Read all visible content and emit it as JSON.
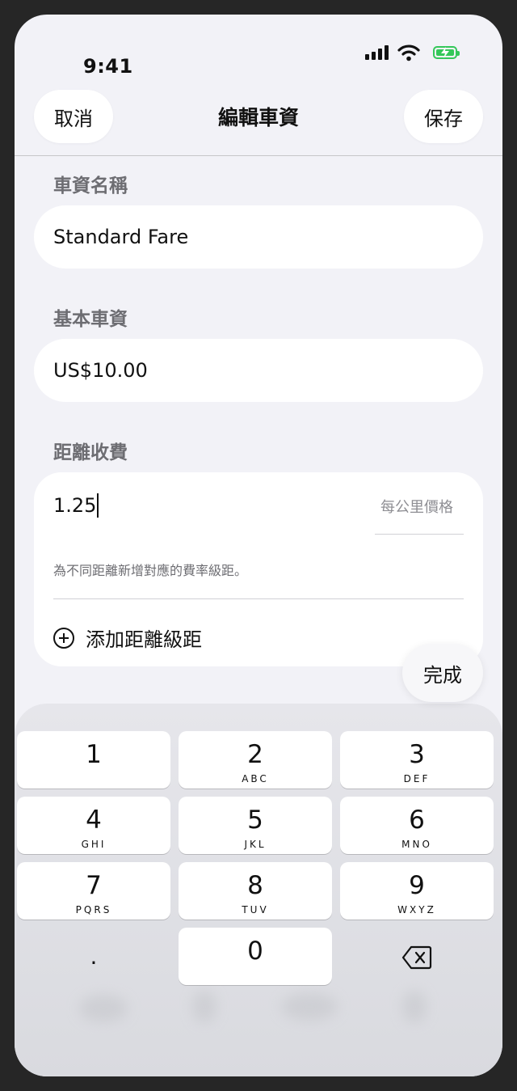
{
  "status_bar": {
    "time": "9:41",
    "icons": [
      "signal-icon",
      "wifi-icon",
      "battery-charging-icon"
    ],
    "battery_color": "#34c759"
  },
  "nav": {
    "cancel_label": "取消",
    "title": "編輯車資",
    "save_label": "保存"
  },
  "form": {
    "fare_name": {
      "label": "車資名稱",
      "value": "Standard Fare"
    },
    "base_fare": {
      "label": "基本車資",
      "value": "US$10.00"
    },
    "distance": {
      "label": "距離收費",
      "value": "1.25",
      "placeholder": "每公里價格",
      "hint": "為不同距離新增對應的費率級距。",
      "add_tier_label": "添加距離級距"
    }
  },
  "keyboard": {
    "done_label": "完成",
    "keys": [
      {
        "digit": "1",
        "letters": ""
      },
      {
        "digit": "2",
        "letters": "ABC"
      },
      {
        "digit": "3",
        "letters": "DEF"
      },
      {
        "digit": "4",
        "letters": "GHI"
      },
      {
        "digit": "5",
        "letters": "JKL"
      },
      {
        "digit": "6",
        "letters": "MNO"
      },
      {
        "digit": "7",
        "letters": "PQRS"
      },
      {
        "digit": "8",
        "letters": "TUV"
      },
      {
        "digit": "9",
        "letters": "WXYZ"
      }
    ],
    "decimal": ".",
    "zero": "0",
    "delete_icon": "backspace-icon"
  }
}
